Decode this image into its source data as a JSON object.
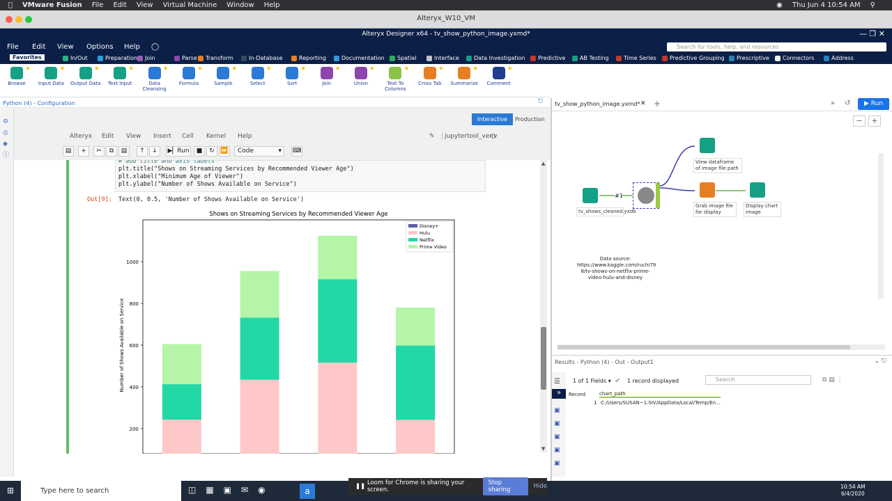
{
  "mac": {
    "app": "VMware Fusion",
    "menus": [
      "File",
      "Edit",
      "View",
      "Virtual Machine",
      "Window",
      "Help"
    ],
    "datetime": "Thu Jun 4  10:54 AM"
  },
  "vm": {
    "title": "Alteryx_W10_VM"
  },
  "alteryx": {
    "title": "Alteryx Designer x64 - tv_show_python_image.yxmd*",
    "menus": [
      "File",
      "Edit",
      "View",
      "Options",
      "Help"
    ],
    "search_placeholder": "Search for tools, help, and resources"
  },
  "categories": [
    {
      "label": "Favorites",
      "color": "#ffffff"
    },
    {
      "label": "In/Out",
      "color": "#2ab27b"
    },
    {
      "label": "Preparation",
      "color": "#2a9fd6"
    },
    {
      "label": "Join",
      "color": "#9b59b6"
    },
    {
      "label": "Parse",
      "color": "#8e44ad"
    },
    {
      "label": "Transform",
      "color": "#e67e22"
    },
    {
      "label": "In-Database",
      "color": "#34495e"
    },
    {
      "label": "Reporting",
      "color": "#e67e22"
    },
    {
      "label": "Documentation",
      "color": "#3498db"
    },
    {
      "label": "Spatial",
      "color": "#27ae60"
    },
    {
      "label": "Interface",
      "color": "#bdc3c7"
    },
    {
      "label": "Data Investigation",
      "color": "#16a085"
    },
    {
      "label": "Predictive",
      "color": "#c0392b"
    },
    {
      "label": "AB Testing",
      "color": "#16a085"
    },
    {
      "label": "Time Series",
      "color": "#c0392b"
    },
    {
      "label": "Predictive Grouping",
      "color": "#c0392b"
    },
    {
      "label": "Prescriptive",
      "color": "#2980b9"
    },
    {
      "label": "Connectors",
      "color": "#ecf0f1"
    },
    {
      "label": "Address",
      "color": "#2980b9"
    }
  ],
  "tools": [
    {
      "label": "Browse",
      "color": "#16a085"
    },
    {
      "label": "Input Data",
      "color": "#16a085"
    },
    {
      "label": "Output Data",
      "color": "#16a085"
    },
    {
      "label": "Text Input",
      "color": "#16a085"
    },
    {
      "label": "Data Cleansing",
      "color": "#2a7ad6"
    },
    {
      "label": "Formula",
      "color": "#2a7ad6"
    },
    {
      "label": "Sample",
      "color": "#2a7ad6"
    },
    {
      "label": "Select",
      "color": "#2a7ad6"
    },
    {
      "label": "Sort",
      "color": "#2a7ad6"
    },
    {
      "label": "Join",
      "color": "#8e44ad"
    },
    {
      "label": "Union",
      "color": "#8e44ad"
    },
    {
      "label": "Text To Columns",
      "color": "#8bc34a"
    },
    {
      "label": "Cross Tab",
      "color": "#e67e22"
    },
    {
      "label": "Summarize",
      "color": "#e67e22"
    },
    {
      "label": "Comment",
      "color": "#1e3d8f"
    }
  ],
  "config": {
    "breadcrumb": "Python (4) - Configuration",
    "interactive": "Interactive",
    "production": "Production"
  },
  "jupyter": {
    "menus": [
      "Alteryx",
      "Edit",
      "View",
      "Insert",
      "Cell",
      "Kernel",
      "Help"
    ],
    "kernel": "jupytertool_venv",
    "run": "Run",
    "cell_type": "Code"
  },
  "cell": {
    "code_lines": [
      "# add title and axis labels",
      "plt.title(\"Shows on Streaming Services by Recommended Viewer Age\")",
      "plt.xlabel(\"Minimum Age of Viewer\")",
      "plt.ylabel(\"Number of Shows Available on Service\")"
    ],
    "out_label": "Out[9]:",
    "out_text": "Text(0, 0.5, 'Number of Shows Available on Service')"
  },
  "chart_data": {
    "type": "bar",
    "stacked": true,
    "title": "Shows on Streaming Services by Recommended Viewer Age",
    "xlabel": "",
    "ylabel": "Number of Shows Available on Service",
    "categories": [
      "",
      "",
      "",
      ""
    ],
    "series": [
      {
        "name": "Disney+",
        "color": "#5d5fa8",
        "values": [
          0,
          0,
          0,
          0
        ]
      },
      {
        "name": "Hulu",
        "color": "#ffc8c8",
        "values": [
          243,
          434,
          516,
          242
        ]
      },
      {
        "name": "Netflix",
        "color": "#22d8a6",
        "values": [
          170,
          298,
          400,
          356
        ]
      },
      {
        "name": "Prime Video",
        "color": "#b4f5a8",
        "values": [
          192,
          223,
          208,
          182
        ]
      }
    ],
    "yticks": [
      200,
      400,
      600,
      800,
      1000
    ],
    "ylim": [
      80,
      1200
    ],
    "legend": "top-right"
  },
  "workflow": {
    "tab": "tv_show_python_image.yxmd*",
    "run": "Run",
    "nodes": {
      "input": "tv_shows_cleaned.yxdb",
      "conn": "#1",
      "view_df": "View dataframe of image file path",
      "grab": "Grab image file for display",
      "display": "Display chart image"
    },
    "note": "Data source: https://www.kaggle.com/ruchi79 8/tv-shows-on-netflix-prime-video-hulu-and-disney"
  },
  "results": {
    "header": "Results - Python (4) - Out - Output1",
    "fields": "1 of 1 Fields",
    "records": "1 record displayed",
    "search_placeholder": "Search",
    "col_record": "Record",
    "col_chart": "chart_path",
    "row_num": "1",
    "row_value": "C:/Users/SUSAN~1.SIV/AppData/Local/Temp/En..."
  },
  "taskbar": {
    "search_placeholder": "Type here to search",
    "loom": "Loom for Chrome is sharing your screen.",
    "stop": "Stop sharing",
    "hide": "Hide",
    "time": "10:54 AM",
    "date": "6/4/2020"
  }
}
